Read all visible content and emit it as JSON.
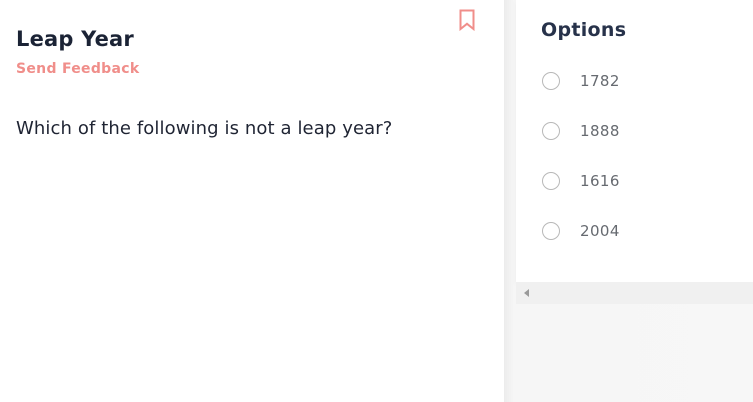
{
  "question": {
    "title": "Leap Year",
    "feedback_link": "Send Feedback",
    "text": "Which of the following is not a leap year?",
    "bookmark_icon": "bookmark-icon"
  },
  "options_panel": {
    "title": "Options",
    "options": [
      {
        "label": "1782",
        "selected": false
      },
      {
        "label": "1888",
        "selected": false
      },
      {
        "label": "1616",
        "selected": false
      },
      {
        "label": "2004",
        "selected": false
      }
    ]
  },
  "colors": {
    "accent": "#f08e8a",
    "title_text": "#1b2335",
    "option_text": "#666a70",
    "radio_border": "#b8b8b8"
  }
}
